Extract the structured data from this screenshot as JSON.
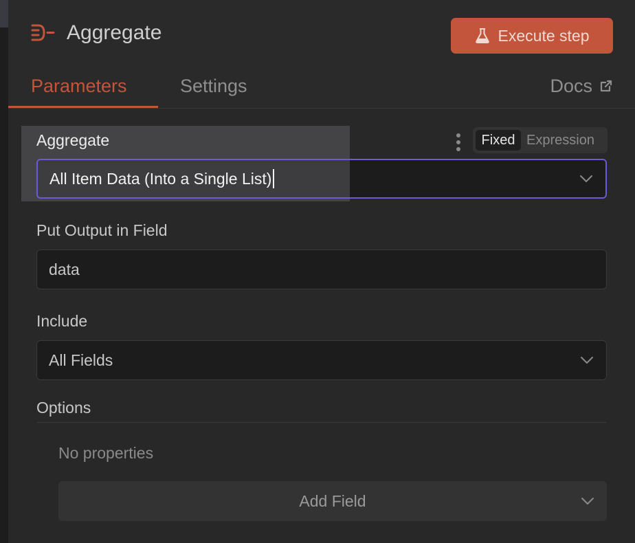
{
  "header": {
    "node_title": "Aggregate",
    "execute_label": "Execute step",
    "icon": "aggregate-node-icon",
    "accent_color": "#c2553b"
  },
  "tabs": [
    {
      "label": "Parameters",
      "active": true
    },
    {
      "label": "Settings",
      "active": false
    },
    {
      "label": "Docs",
      "active": false,
      "icon": "external-link-icon"
    }
  ],
  "fields": {
    "aggregate": {
      "label": "Aggregate",
      "value": "All Item Data (Into a Single List)",
      "mode_fixed": "Fixed",
      "mode_expression": "Expression",
      "focus_color": "#6b5bd6"
    },
    "output_field": {
      "label": "Put Output in Field",
      "value": "data"
    },
    "include": {
      "label": "Include",
      "value": "All Fields"
    },
    "options": {
      "label": "Options",
      "empty_text": "No properties",
      "add_field_label": "Add Field"
    }
  }
}
